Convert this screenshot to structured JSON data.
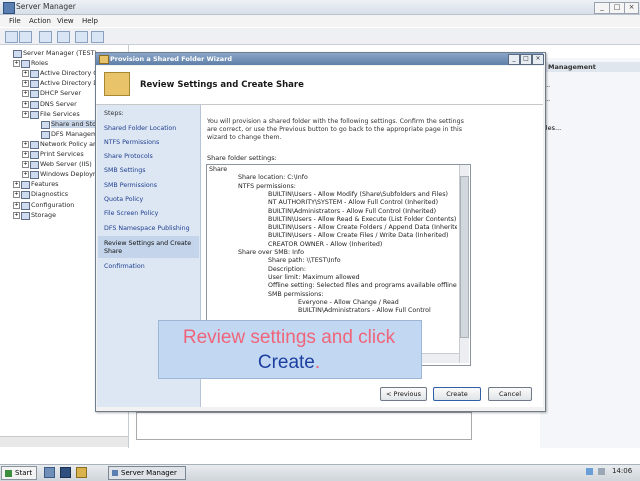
{
  "window": {
    "title": "Server Manager",
    "menu": [
      "File",
      "Action",
      "View",
      "Help"
    ]
  },
  "tree": {
    "items": [
      {
        "label": "Server Manager (TEST)",
        "level": 0
      },
      {
        "label": "Roles",
        "level": 1
      },
      {
        "label": "Active Directory C",
        "level": 2
      },
      {
        "label": "Active Directory D",
        "level": 2
      },
      {
        "label": "DHCP Server",
        "level": 2
      },
      {
        "label": "DNS Server",
        "level": 2
      },
      {
        "label": "File Services",
        "level": 2
      },
      {
        "label": "Share and Sto",
        "level": 3
      },
      {
        "label": "DFS Managem",
        "level": 3
      },
      {
        "label": "Network Policy and",
        "level": 2
      },
      {
        "label": "Print Services",
        "level": 2
      },
      {
        "label": "Web Server (IIS)",
        "level": 2
      },
      {
        "label": "Windows Deployme",
        "level": 2
      },
      {
        "label": "Features",
        "level": 1
      },
      {
        "label": "Diagnostics",
        "level": 1
      },
      {
        "label": "Configuration",
        "level": 1
      },
      {
        "label": "Storage",
        "level": 1
      }
    ]
  },
  "actions_pane": {
    "header": "Management",
    "items": [
      "...",
      "...",
      "iles..."
    ]
  },
  "wizard": {
    "title": "Provision a Shared Folder Wizard",
    "header_title": "Review Settings and Create Share",
    "steps_header": "Steps:",
    "steps": [
      "Shared Folder Location",
      "NTFS Permissions",
      "Share Protocols",
      "SMB Settings",
      "SMB Permissions",
      "Quota Policy",
      "File Screen Policy",
      "DFS Namespace Publishing",
      "Review Settings and Create Share",
      "Confirmation"
    ],
    "current_step": "Review Settings and Create Share",
    "intro": "You will provision a shared folder with the following settings. Confirm the settings are correct, or use the Previous button to go back to the appropriate page in this wizard to change them.",
    "settings_label": "Share folder settings:",
    "settings_lines": [
      {
        "indent": 0,
        "text": "Share"
      },
      {
        "indent": 1,
        "text": "Share location: C:\\Info"
      },
      {
        "indent": 1,
        "text": "NTFS permissions:"
      },
      {
        "indent": 2,
        "text": "BUILTIN\\Users - Allow Modify (Share\\Subfolders and Files)"
      },
      {
        "indent": 2,
        "text": "NT AUTHORITY\\SYSTEM - Allow Full Control (Inherited)"
      },
      {
        "indent": 2,
        "text": "BUILTIN\\Administrators - Allow Full Control (Inherited)"
      },
      {
        "indent": 2,
        "text": "BUILTIN\\Users - Allow Read & Execute (List Folder Contents)"
      },
      {
        "indent": 2,
        "text": "BUILTIN\\Users - Allow Create Folders / Append Data (Inherited)"
      },
      {
        "indent": 2,
        "text": "BUILTIN\\Users - Allow Create Files / Write Data (Inherited)"
      },
      {
        "indent": 2,
        "text": "CREATOR OWNER - Allow (Inherited)"
      },
      {
        "indent": 1,
        "text": "Share over SMB: Info"
      },
      {
        "indent": 2,
        "text": "Share path: \\\\TEST\\Info"
      },
      {
        "indent": 2,
        "text": "Description:"
      },
      {
        "indent": 2,
        "text": "User limit: Maximum allowed"
      },
      {
        "indent": 2,
        "text": "Offline setting: Selected files and programs available offline"
      },
      {
        "indent": 2,
        "text": "SMB permissions:"
      },
      {
        "indent": 3,
        "text": "Everyone - Allow Change / Read"
      },
      {
        "indent": 3,
        "text": "BUILTIN\\Administrators - Allow Full Control"
      }
    ],
    "buttons": {
      "previous": "< Previous",
      "create": "Create",
      "cancel": "Cancel"
    }
  },
  "callout": {
    "line1": "Review settings and click",
    "line2": "Create",
    "line2_suffix": "."
  },
  "taskbar": {
    "start": "Start",
    "task": "Server Manager",
    "clock": "14:06"
  }
}
